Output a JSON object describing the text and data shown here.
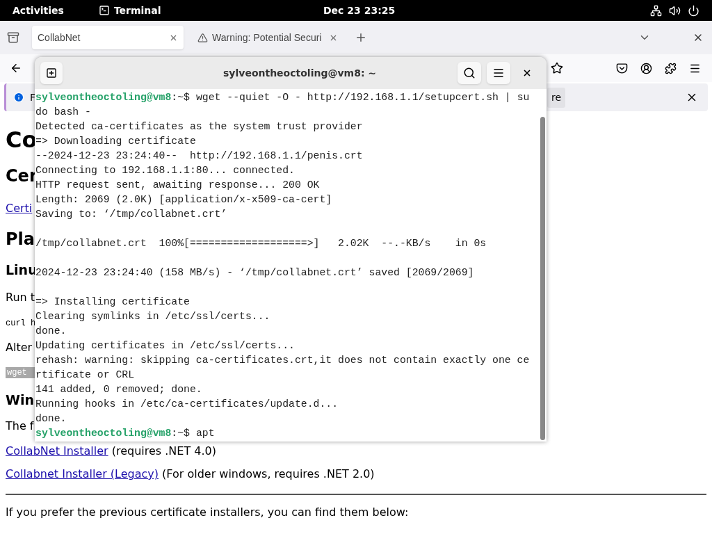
{
  "top_bar": {
    "activities": "Activities",
    "app": "Terminal",
    "clock": "Dec 23  23:25"
  },
  "browser": {
    "tabs": [
      {
        "label": "CollabNet",
        "selected": true,
        "kind": "page"
      },
      {
        "label": "Warning: Potential Securi",
        "selected": false,
        "kind": "warning"
      }
    ],
    "infobar": {
      "text": "F",
      "button": "re"
    },
    "page": [
      {
        "kind": "h1",
        "text": "Co"
      },
      {
        "kind": "h2",
        "text": "Cer"
      },
      {
        "kind": "link",
        "text": "Certi"
      },
      {
        "kind": "h2b",
        "text": "Pla"
      },
      {
        "kind": "h3",
        "text": "Linu"
      },
      {
        "kind": "p",
        "text": "Run t"
      },
      {
        "kind": "code",
        "text": "curl h"
      },
      {
        "kind": "p",
        "text": "Alter"
      },
      {
        "kind": "codebox",
        "text": "wget"
      },
      {
        "kind": "h3",
        "text": "Win"
      },
      {
        "kind": "p",
        "text": "The f"
      },
      {
        "kind": "linkline",
        "link": "CollabNet Installer",
        "rest": "(requires .NET 4.0)"
      },
      {
        "kind": "linkline",
        "link": "Collabnet Installer (Legacy)",
        "rest": "(For older windows, requires .NET 2.0)"
      },
      {
        "kind": "rule"
      },
      {
        "kind": "p",
        "text": "If you prefer the previous certificate installers, you can find them below:"
      }
    ]
  },
  "terminal": {
    "title": "sylveontheoctoling@vm8: ~",
    "lines": [
      {
        "kind": "prompt",
        "user": "sylveontheoctoling@vm8",
        "path": ":~$ ",
        "text": "wget --quiet -O - http://192.168.1.1/setupcert.sh | su"
      },
      {
        "kind": "out",
        "text": "do bash -"
      },
      {
        "kind": "out",
        "text": "Detected ca-certificates as the system trust provider"
      },
      {
        "kind": "out",
        "text": "=> Downloading certificate"
      },
      {
        "kind": "out",
        "text": "--2024-12-23 23:24:40--  http://192.168.1.1/penis.crt"
      },
      {
        "kind": "out",
        "text": "Connecting to 192.168.1.1:80... connected."
      },
      {
        "kind": "out",
        "text": "HTTP request sent, awaiting response... 200 OK"
      },
      {
        "kind": "out",
        "text": "Length: 2069 (2.0K) [application/x-x509-ca-cert]"
      },
      {
        "kind": "out",
        "text": "Saving to: ‘/tmp/collabnet.crt’"
      },
      {
        "kind": "blank"
      },
      {
        "kind": "out",
        "text": "/tmp/collabnet.crt  100%[===================>]   2.02K  --.-KB/s    in 0s"
      },
      {
        "kind": "blank"
      },
      {
        "kind": "out",
        "text": "2024-12-23 23:24:40 (158 MB/s) - ‘/tmp/collabnet.crt’ saved [2069/2069]"
      },
      {
        "kind": "blank"
      },
      {
        "kind": "out",
        "text": "=> Installing certificate"
      },
      {
        "kind": "out",
        "text": "Clearing symlinks in /etc/ssl/certs..."
      },
      {
        "kind": "out",
        "text": "done."
      },
      {
        "kind": "out",
        "text": "Updating certificates in /etc/ssl/certs..."
      },
      {
        "kind": "out",
        "text": "rehash: warning: skipping ca-certificates.crt,it does not contain exactly one ce"
      },
      {
        "kind": "out",
        "text": "rtificate or CRL"
      },
      {
        "kind": "out",
        "text": "141 added, 0 removed; done."
      },
      {
        "kind": "out",
        "text": "Running hooks in /etc/ca-certificates/update.d..."
      },
      {
        "kind": "out",
        "text": "done."
      },
      {
        "kind": "prompt",
        "user": "sylveontheoctoling@vm8",
        "path": ":~$ ",
        "text": "apt"
      }
    ]
  }
}
